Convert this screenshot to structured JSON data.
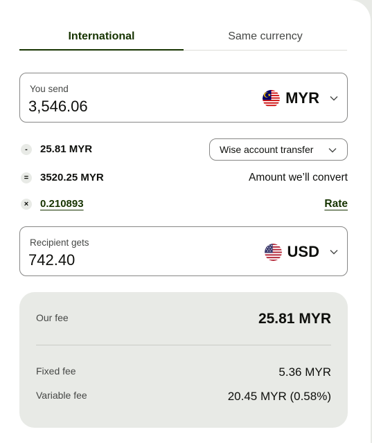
{
  "tabs": {
    "international": "International",
    "same_currency": "Same currency"
  },
  "send": {
    "label": "You send",
    "amount": "3,546.06",
    "currency": "MYR",
    "flag_icon": "malaysia-flag-icon"
  },
  "breakdown": {
    "fee": {
      "operator": "-",
      "value": "25.81 MYR"
    },
    "method": "Wise account transfer",
    "convert": {
      "operator": "=",
      "value": "3520.25 MYR",
      "label": "Amount we’ll convert"
    },
    "rate": {
      "operator": "×",
      "value": "0.210893",
      "label": "Rate"
    }
  },
  "receive": {
    "label": "Recipient gets",
    "amount": "742.40",
    "currency": "USD",
    "flag_icon": "usa-flag-icon"
  },
  "fees": {
    "our_fee_label": "Our fee",
    "our_fee_value": "25.81 MYR",
    "fixed_label": "Fixed fee",
    "fixed_value": "5.36 MYR",
    "variable_label": "Variable fee",
    "variable_value": "20.45 MYR (0.58%)"
  },
  "colors": {
    "forest_green": "#163300",
    "panel_grey": "#e8eae6",
    "border": "#868685"
  }
}
